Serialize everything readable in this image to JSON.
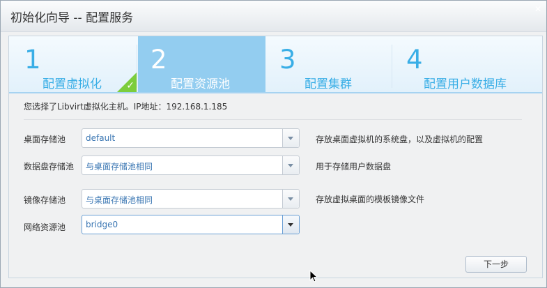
{
  "window": {
    "title": "初始化向导 -- 配置服务",
    "close_glyph": "✕"
  },
  "steps": [
    {
      "num": "1",
      "label": "配置虚拟化",
      "state": "done"
    },
    {
      "num": "2",
      "label": "配置资源池",
      "state": "active"
    },
    {
      "num": "3",
      "label": "配置集群",
      "state": "pending"
    },
    {
      "num": "4",
      "label": "配置用户数据库",
      "state": "pending"
    }
  ],
  "check_glyph": "✓",
  "info_text": "您选择了Libvirt虚拟化主机。IP地址：192.168.1.185",
  "form": {
    "desktop_pool": {
      "label": "桌面存储池",
      "value": "default",
      "desc": "存放桌面虚拟机的系统盘，以及虚拟机的配置"
    },
    "data_pool": {
      "label": "数据盘存储池",
      "value": "与桌面存储池相同",
      "desc": "用于存储用户数据盘"
    },
    "image_pool": {
      "label": "镜像存储池",
      "value": "与桌面存储池相同",
      "desc": "存放虚拟桌面的模板镜像文件"
    },
    "network_pool": {
      "label": "网络资源池",
      "value": "bridge0"
    }
  },
  "buttons": {
    "next": "下一步"
  },
  "colors": {
    "accent": "#39aee6",
    "active_step": "#93cdf0",
    "done_check": "#7ccd3c",
    "field_value": "#3b77b3"
  },
  "icons": {
    "close": "close-icon",
    "check": "checkmark-icon",
    "dropdown": "chevron-down-icon",
    "cursor": "mouse-pointer-icon"
  }
}
